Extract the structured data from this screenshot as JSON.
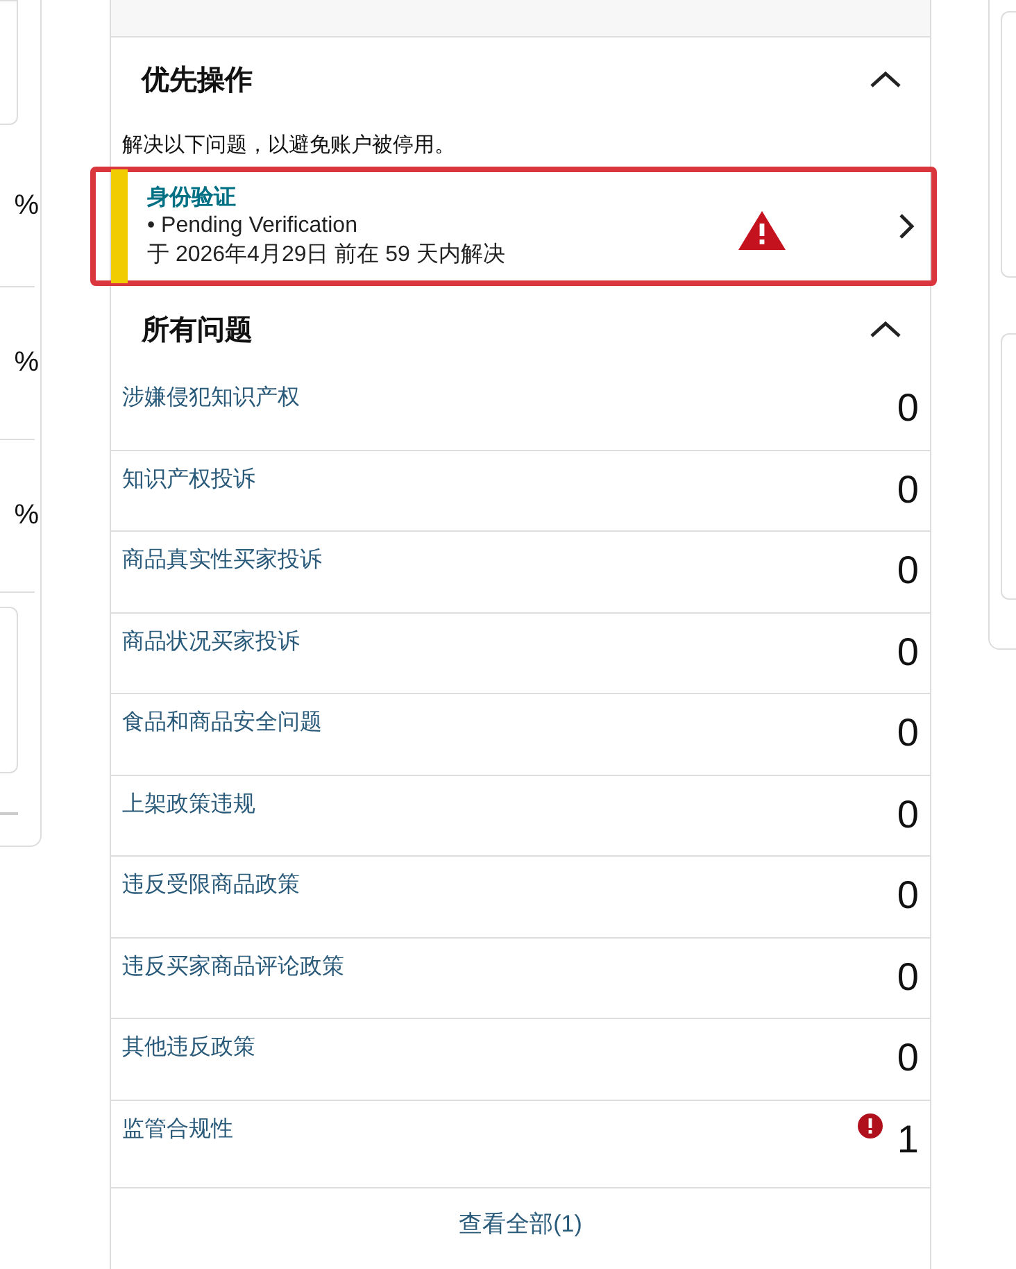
{
  "left_panel": {
    "percentages": [
      "%",
      "%",
      "%"
    ]
  },
  "priority_actions": {
    "title": "优先操作",
    "expanded": true,
    "description": "解决以下问题，以避免账户被停用。",
    "items": [
      {
        "title": "身份验证",
        "status": "• Pending Verification",
        "deadline": "于 2026年4月29日 前在 59 天内解决",
        "highlighted": true
      }
    ]
  },
  "all_issues": {
    "title": "所有问题",
    "expanded": true,
    "rows": [
      {
        "name": "涉嫌侵犯知识产权",
        "count": "0",
        "alert": false
      },
      {
        "name": "知识产权投诉",
        "count": "0",
        "alert": false
      },
      {
        "name": "商品真实性买家投诉",
        "count": "0",
        "alert": false
      },
      {
        "name": "商品状况买家投诉",
        "count": "0",
        "alert": false
      },
      {
        "name": "食品和商品安全问题",
        "count": "0",
        "alert": false
      },
      {
        "name": "上架政策违规",
        "count": "0",
        "alert": false
      },
      {
        "name": "违反受限商品政策",
        "count": "0",
        "alert": false
      },
      {
        "name": "违反买家商品评论政策",
        "count": "0",
        "alert": false
      },
      {
        "name": "其他违反政策",
        "count": "0",
        "alert": false
      },
      {
        "name": "监管合规性",
        "count": "1",
        "alert": true
      }
    ],
    "view_all": "查看全部(1)"
  }
}
